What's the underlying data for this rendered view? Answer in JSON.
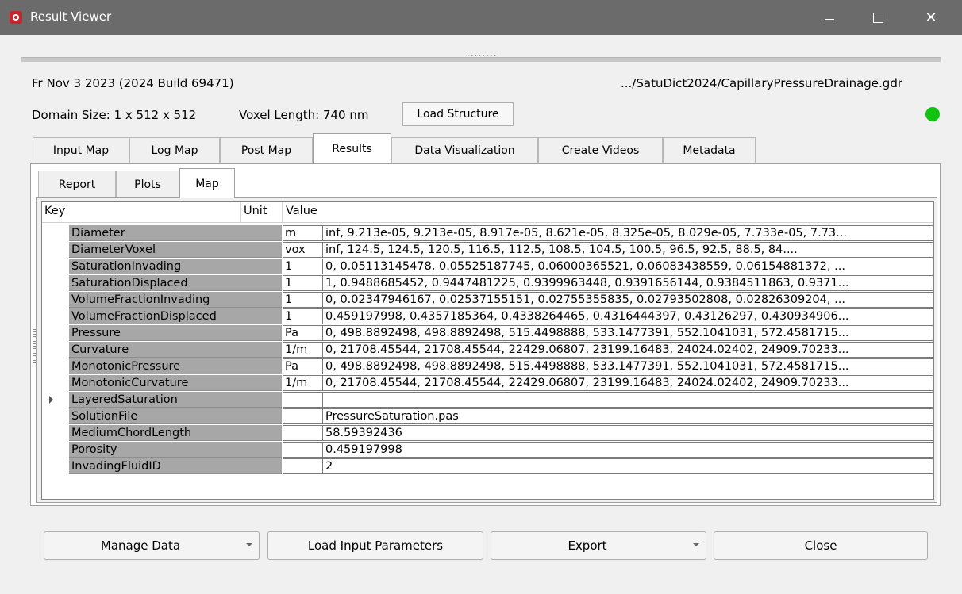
{
  "window": {
    "title": "Result Viewer",
    "minimize_glyph": "—",
    "maximize_glyph": "☐",
    "close_glyph": "✕"
  },
  "header": {
    "splitter_handle": "........",
    "date_build": "Fr Nov 3 2023 (2024 Build 69471)",
    "file_path": ".../SatuDict2024/CapillaryPressureDrainage.gdr",
    "domain_size": "Domain Size: 1 x 512 x 512",
    "voxel_length": "Voxel Length: 740 nm",
    "load_structure_label": "Load Structure",
    "status_color": "#12c212"
  },
  "tabs": [
    "Input Map",
    "Log Map",
    "Post Map",
    "Results",
    "Data Visualization",
    "Create Videos",
    "Metadata"
  ],
  "active_tab": "Results",
  "subtabs": [
    "Report",
    "Plots",
    "Map"
  ],
  "active_subtab": "Map",
  "table": {
    "headers": [
      "Key",
      "Unit",
      "Value"
    ],
    "rows": [
      {
        "key": "Diameter",
        "unit": "m",
        "value": "inf, 9.213e-05, 9.213e-05, 8.917e-05, 8.621e-05, 8.325e-05, 8.029e-05, 7.733e-05, 7.73..."
      },
      {
        "key": "DiameterVoxel",
        "unit": "vox",
        "value": "inf, 124.5, 124.5, 120.5, 116.5, 112.5, 108.5, 104.5, 100.5, 96.5, 92.5, 88.5, 84...."
      },
      {
        "key": "SaturationInvading",
        "unit": "1",
        "value": "0, 0.05113145478, 0.05525187745, 0.06000365521, 0.06083438559, 0.06154881372, ..."
      },
      {
        "key": "SaturationDisplaced",
        "unit": "1",
        "value": "1, 0.9488685452, 0.9447481225, 0.9399963448, 0.9391656144, 0.9384511863, 0.9371..."
      },
      {
        "key": "VolumeFractionInvading",
        "unit": "1",
        "value": "0, 0.02347946167, 0.02537155151, 0.02755355835, 0.02793502808, 0.02826309204, ..."
      },
      {
        "key": "VolumeFractionDisplaced",
        "unit": "1",
        "value": "0.459197998, 0.4357185364, 0.4338264465, 0.4316444397, 0.43126297, 0.430934906..."
      },
      {
        "key": "Pressure",
        "unit": "Pa",
        "value": "0, 498.8892498, 498.8892498, 515.4498888, 533.1477391, 552.1041031, 572.4581715..."
      },
      {
        "key": "Curvature",
        "unit": "1/m",
        "value": "0, 21708.45544, 21708.45544, 22429.06807, 23199.16483, 24024.02402, 24909.70233..."
      },
      {
        "key": "MonotonicPressure",
        "unit": "Pa",
        "value": "0, 498.8892498, 498.8892498, 515.4498888, 533.1477391, 552.1041031, 572.4581715..."
      },
      {
        "key": "MonotonicCurvature",
        "unit": "1/m",
        "value": "0, 21708.45544, 21708.45544, 22429.06807, 23199.16483, 24024.02402, 24909.70233..."
      },
      {
        "key": "LayeredSaturation",
        "unit": "",
        "value": "",
        "expandable": true
      },
      {
        "key": "SolutionFile",
        "unit": "",
        "value": "PressureSaturation.pas"
      },
      {
        "key": "MediumChordLength",
        "unit": "",
        "value": "58.59392436"
      },
      {
        "key": "Porosity",
        "unit": "",
        "value": "0.459197998"
      },
      {
        "key": "InvadingFluidID",
        "unit": "",
        "value": "2"
      }
    ]
  },
  "footer": {
    "manage_data_label": "Manage Data",
    "load_input_label": "Load Input Parameters",
    "export_label": "Export",
    "close_label": "Close"
  }
}
